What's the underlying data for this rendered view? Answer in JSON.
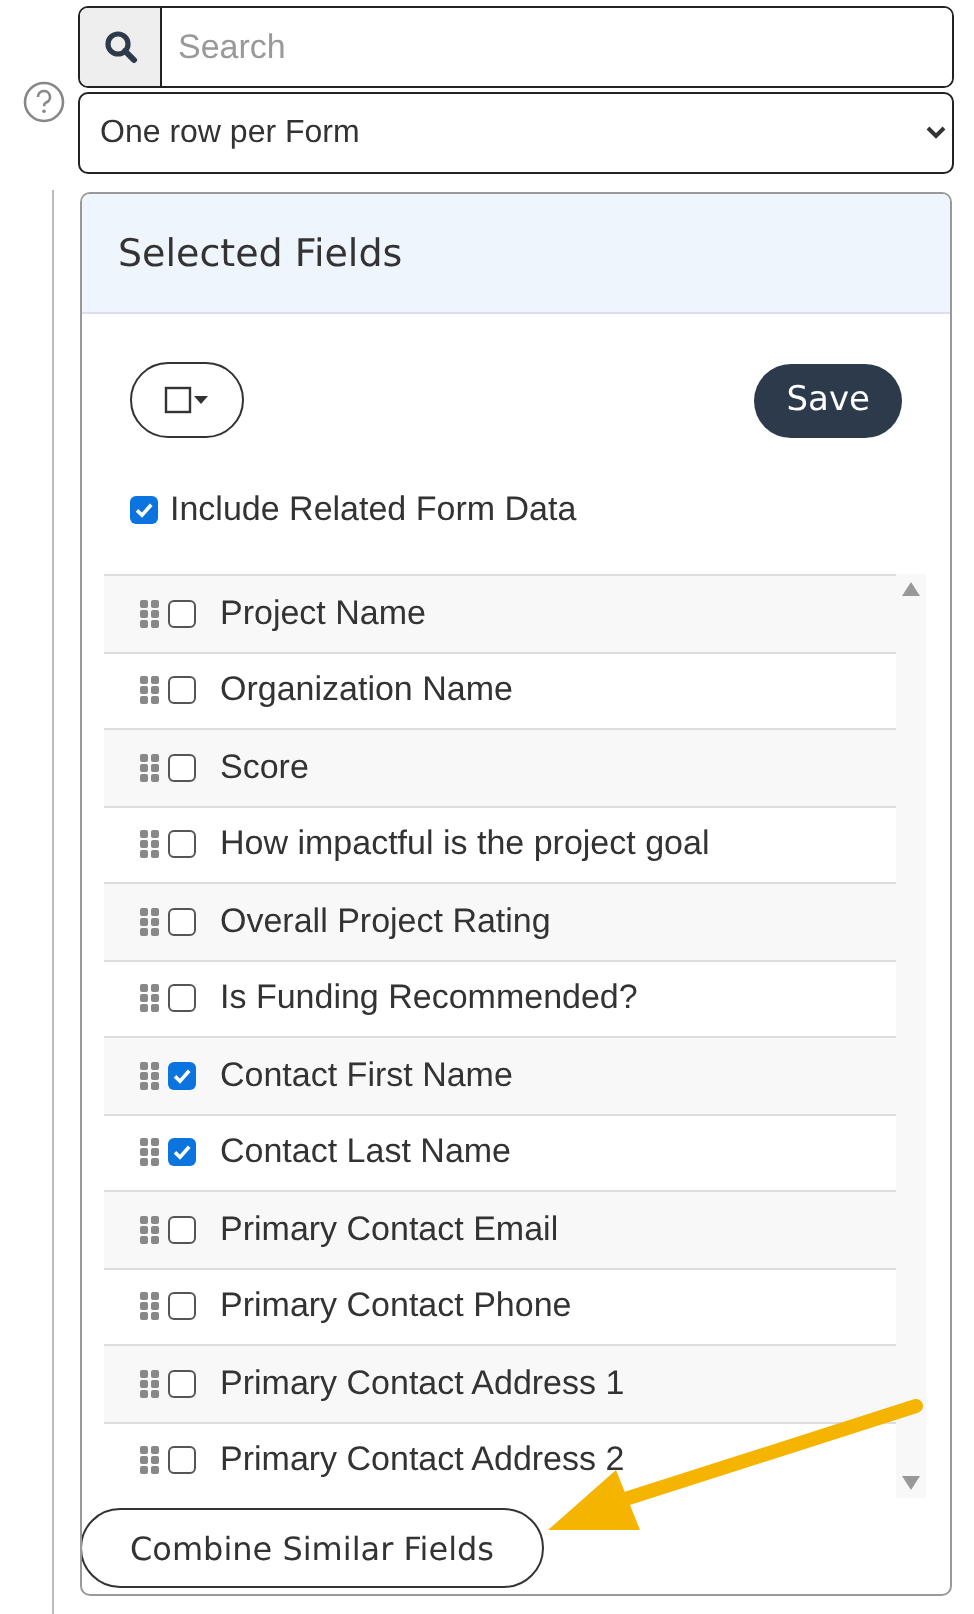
{
  "search": {
    "placeholder": "Search"
  },
  "mode_select": {
    "value": "One row per Form"
  },
  "panel": {
    "title": "Selected Fields",
    "save_label": "Save",
    "include_related": {
      "label": "Include Related Form Data",
      "checked": true
    }
  },
  "fields": [
    {
      "label": "Project Name",
      "checked": false
    },
    {
      "label": "Organization Name",
      "checked": false
    },
    {
      "label": "Score",
      "checked": false
    },
    {
      "label": "How impactful is the project goal",
      "checked": false
    },
    {
      "label": "Overall Project Rating",
      "checked": false
    },
    {
      "label": "Is Funding Recommended?",
      "checked": false
    },
    {
      "label": "Contact First Name",
      "checked": true
    },
    {
      "label": "Contact Last Name",
      "checked": true
    },
    {
      "label": "Primary Contact Email",
      "checked": false
    },
    {
      "label": "Primary Contact Phone",
      "checked": false
    },
    {
      "label": "Primary Contact Address 1",
      "checked": false
    },
    {
      "label": "Primary Contact Address 2",
      "checked": false
    }
  ],
  "combine_button": "Combine Similar Fields"
}
